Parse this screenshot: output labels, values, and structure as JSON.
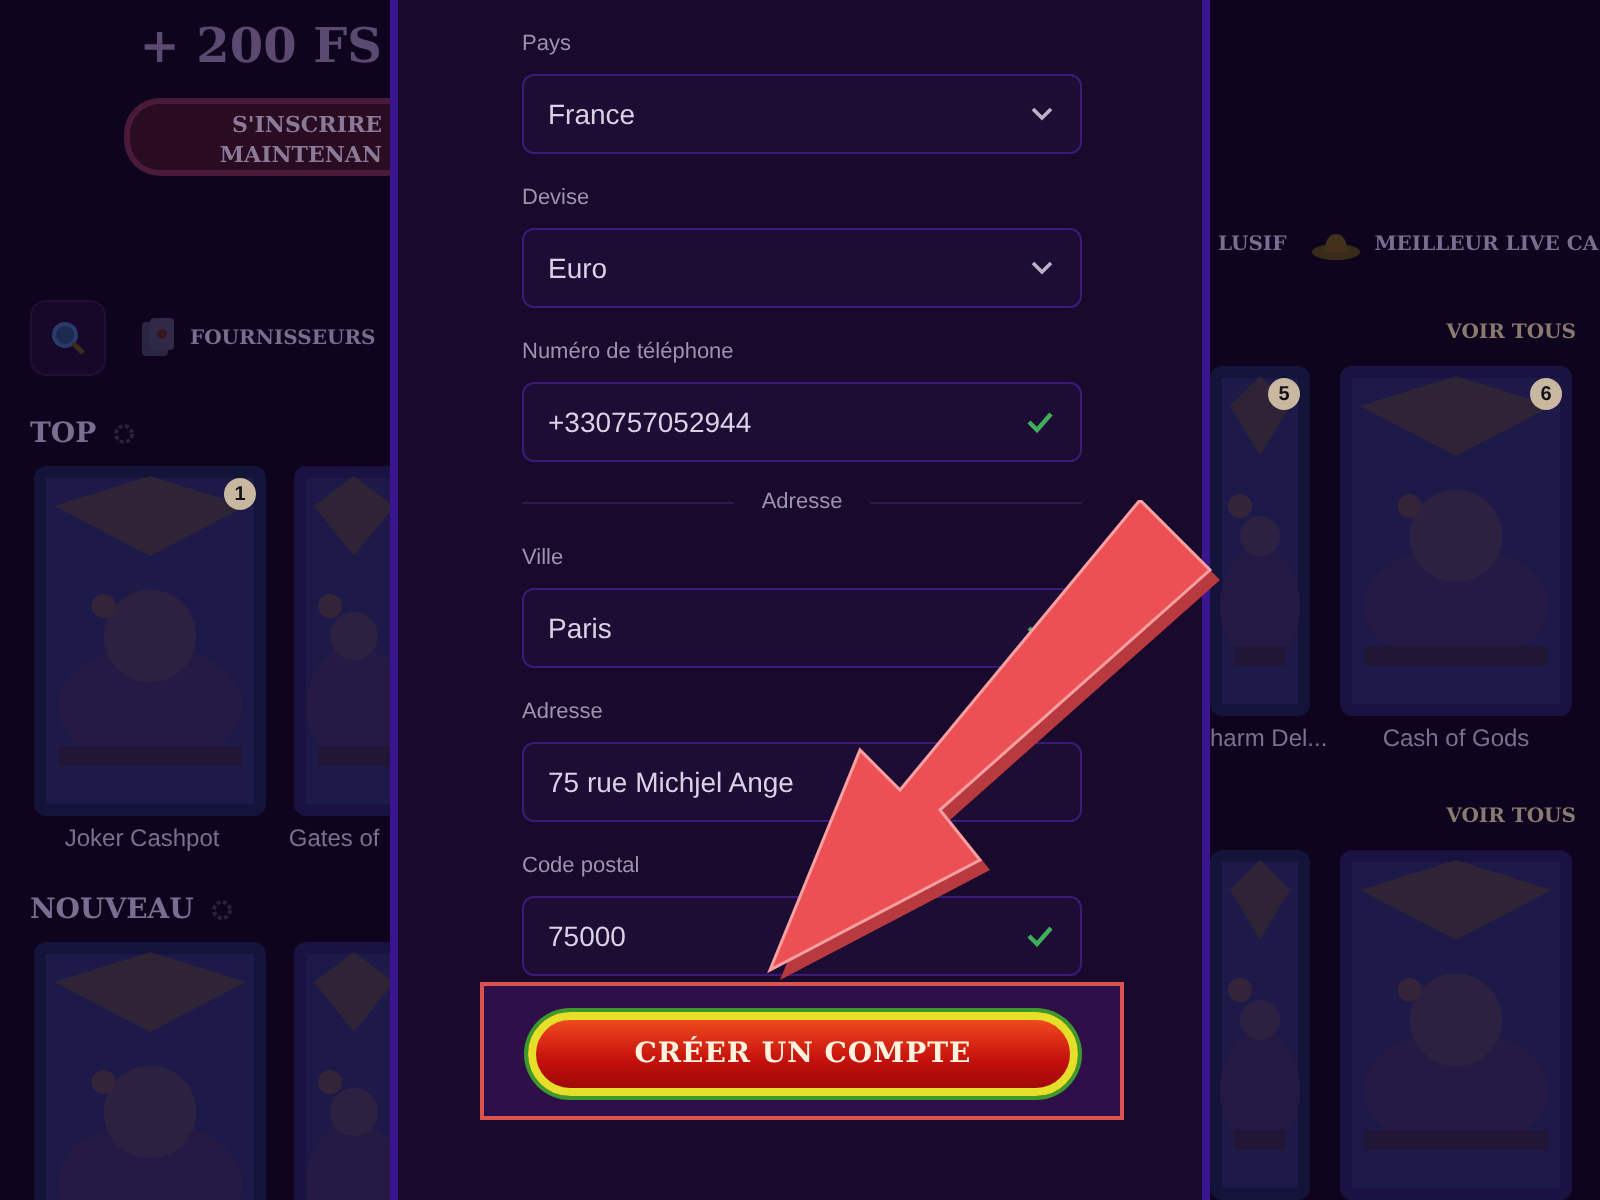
{
  "background_page": {
    "promo": "+ 200 FS",
    "signup_button": "S'INSCRIRE MAINTENAN",
    "nav_left": [
      {
        "kind": "search"
      },
      {
        "kind": "menu",
        "label": "FOURNISSEURS"
      }
    ],
    "nav_right": [
      {
        "kind": "menu",
        "label": "LUSIF"
      },
      {
        "kind": "menu",
        "label": "MEILLEUR LIVE CA"
      }
    ],
    "sections": [
      {
        "title": "TOP",
        "link": "VOIR TOUS",
        "left_games": [
          {
            "name": "Joker Cashpot",
            "badge": "1"
          },
          {
            "name": "Gates of"
          }
        ],
        "right_games": [
          {
            "name": "harm Del...",
            "badge": "5"
          },
          {
            "name": "Cash of Gods",
            "badge": "6"
          }
        ]
      },
      {
        "title": "NOUVEAU",
        "link": "VOIR TOUS"
      }
    ]
  },
  "modal": {
    "fields": [
      {
        "label": "Pays",
        "value": "France",
        "kind": "select"
      },
      {
        "label": "Devise",
        "value": "Euro",
        "kind": "select"
      },
      {
        "label": "Numéro de téléphone",
        "value": "+330757052944",
        "kind": "text",
        "valid": true
      },
      {
        "kind": "divider",
        "label": "Adresse"
      },
      {
        "label": "Ville",
        "value": "Paris",
        "kind": "text",
        "valid": true
      },
      {
        "label": "Adresse",
        "value": "75 rue Michjel Ange",
        "kind": "text"
      },
      {
        "label": "Code postal",
        "value": "75000",
        "kind": "text",
        "valid": true
      }
    ],
    "submit_button": "CRÉER UN COMPTE"
  }
}
